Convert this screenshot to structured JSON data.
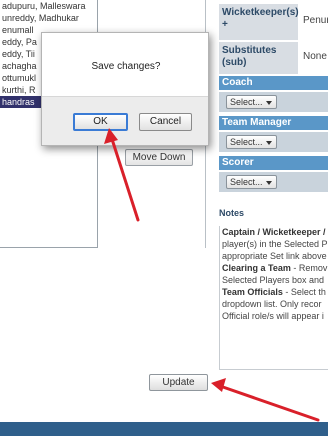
{
  "players": [
    "adupuru, Malleswara",
    "unreddy, Madhukar",
    "enumall",
    "eddy, Pa",
    "eddy, Tii",
    "achagha",
    "ottumukl",
    "kurthi, R",
    "handras"
  ],
  "buttons": {
    "move_down": "Move Down",
    "update": "Update"
  },
  "details": {
    "wicketkeeper_label": "Wicketkeeper(s) +",
    "wicketkeeper_value": "Penur",
    "substitutes_label": "Substitutes (sub)",
    "substitutes_value": "None"
  },
  "sections": {
    "coach": "Coach",
    "team_manager": "Team Manager",
    "scorer": "Scorer"
  },
  "selects": {
    "coach_value": "Select...",
    "team_manager_value": "Select...",
    "scorer_value": "Select..."
  },
  "notes": {
    "title": "Notes",
    "lines": [
      {
        "bold": "Captain / Wicketkeeper /",
        "text": ""
      },
      {
        "bold": "",
        "text": "player(s) in the Selected P"
      },
      {
        "bold": "",
        "text": "appropriate Set link above"
      },
      {
        "bold": "Clearing a Team",
        "text": " - Remov"
      },
      {
        "bold": "",
        "text": "Selected Players box and"
      },
      {
        "bold": "Team Officials",
        "text": " - Select th"
      },
      {
        "bold": "",
        "text": "dropdown list. Only recor"
      },
      {
        "bold": "",
        "text": "Official role/s will appear i"
      }
    ]
  },
  "dialog": {
    "message": "Save changes?",
    "ok_label": "OK",
    "cancel_label": "Cancel"
  },
  "colors": {
    "section_bar": "#5a97c8",
    "label_bg": "#d8dde3",
    "selected_item": "#31316b",
    "arrow": "#d9202a",
    "footer": "#2f5f8b"
  }
}
